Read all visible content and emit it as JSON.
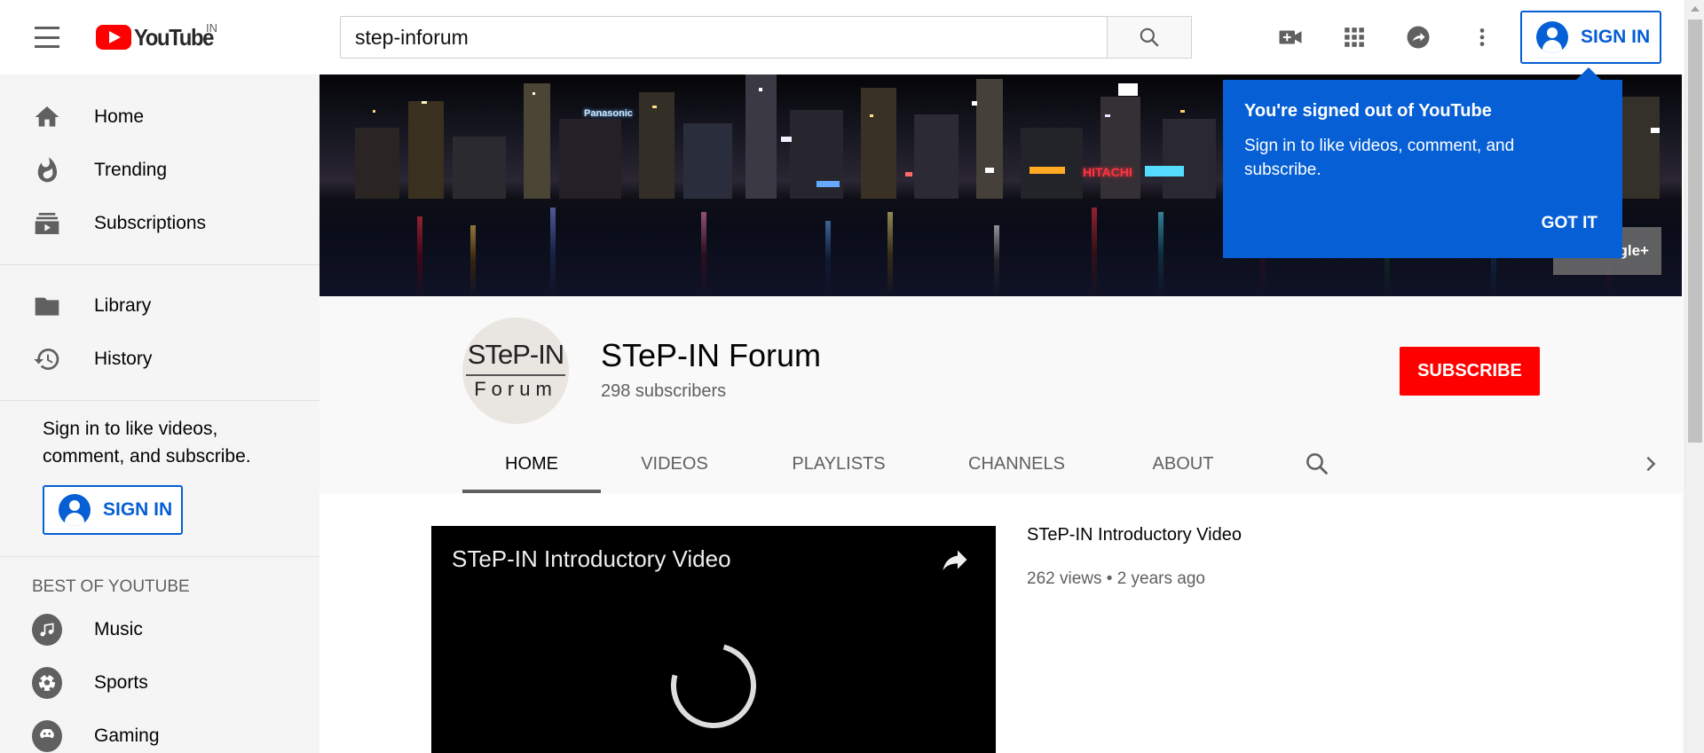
{
  "masthead": {
    "logo_text": "YouTube",
    "country": "IN",
    "search": {
      "value": "step-inforum",
      "placeholder": "Search"
    },
    "signin_label": "SIGN IN"
  },
  "sidebar": {
    "main_items": [
      {
        "label": "Home",
        "icon": "home-icon"
      },
      {
        "label": "Trending",
        "icon": "flame-icon"
      },
      {
        "label": "Subscriptions",
        "icon": "subscriptions-icon"
      }
    ],
    "library_items": [
      {
        "label": "Library",
        "icon": "folder-icon"
      },
      {
        "label": "History",
        "icon": "history-icon"
      }
    ],
    "signin_prompt": "Sign in to like videos, comment, and subscribe.",
    "signin_label": "SIGN IN",
    "best_of_title": "BEST OF YOUTUBE",
    "best_of_items": [
      {
        "label": "Music",
        "icon": "music-icon"
      },
      {
        "label": "Sports",
        "icon": "sports-icon"
      },
      {
        "label": "Gaming",
        "icon": "gaming-icon"
      }
    ]
  },
  "banner": {
    "signs": [
      "Panasonic",
      "HITACHI"
    ],
    "social_link_label": "gle+"
  },
  "channel": {
    "avatar_line1": "STeP-IN",
    "avatar_line2": "Forum",
    "name": "STeP-IN Forum",
    "subscribers": "298 subscribers",
    "subscribe_label": "SUBSCRIBE",
    "tabs": [
      {
        "label": "HOME",
        "active": true
      },
      {
        "label": "VIDEOS",
        "active": false
      },
      {
        "label": "PLAYLISTS",
        "active": false
      },
      {
        "label": "CHANNELS",
        "active": false
      },
      {
        "label": "ABOUT",
        "active": false
      }
    ]
  },
  "featured_video": {
    "player_title": "STeP-IN Introductory Video",
    "title": "STeP-IN Introductory Video",
    "views": "262 views",
    "age": "2 years ago",
    "meta": "262 views • 2 years ago"
  },
  "tooltip": {
    "title": "You're signed out of YouTube",
    "body": "Sign in to like videos, comment, and subscribe.",
    "button": "GOT IT"
  },
  "colors": {
    "brand_red": "#ff0000",
    "accent_blue": "#065fd4",
    "text_secondary": "#606060"
  }
}
